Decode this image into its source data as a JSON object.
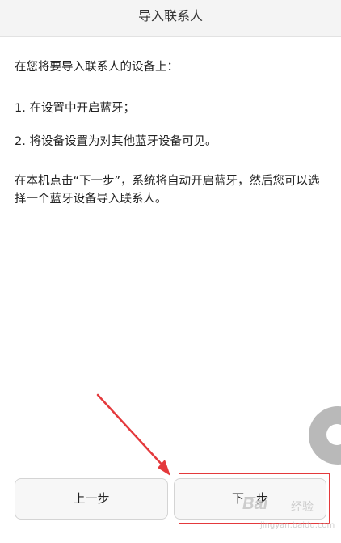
{
  "header": {
    "title": "导入联系人"
  },
  "content": {
    "intro": "在您将要导入联系人的设备上：",
    "steps": [
      "1. 在设置中开启蓝牙；",
      "2. 将设备设置为对其他蓝牙设备可见。"
    ],
    "note": "在本机点击“下一步”，系统将自动开启蓝牙，然后您可以选择一个蓝牙设备导入联系人。"
  },
  "buttons": {
    "prev_label": "上一步",
    "next_label": "下一步"
  },
  "annotation": {
    "color": "#e4393c"
  },
  "watermark": {
    "logo": "Bai",
    "brand": "经验",
    "url": "jingyan.baidu.com"
  }
}
